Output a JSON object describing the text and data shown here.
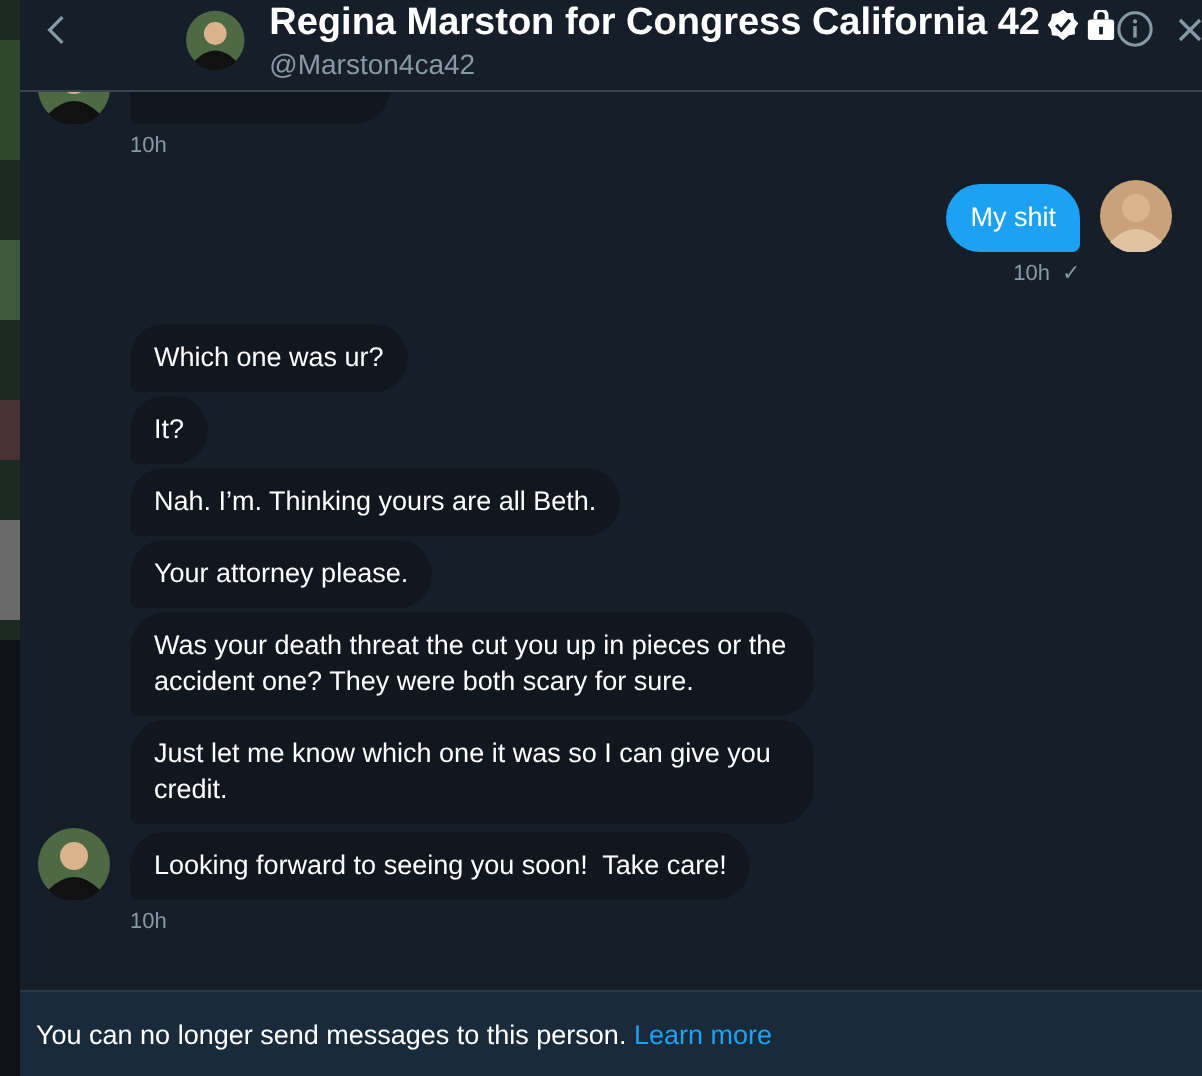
{
  "header": {
    "title": "Regina Marston for Congress California 42",
    "handle": "@Marston4ca42",
    "verified": true
  },
  "messages": [
    {
      "kind": "received",
      "cut_off": true,
      "show_avatar": true,
      "time": "10h"
    },
    {
      "kind": "sent",
      "text": "My shit",
      "show_avatar": true,
      "time": "10h",
      "status": "✓"
    },
    {
      "kind": "received",
      "text": "Which one was ur?",
      "show_avatar": false
    },
    {
      "kind": "received",
      "text": "It?",
      "show_avatar": false
    },
    {
      "kind": "received",
      "text": "Nah. I’m. Thinking yours are all Beth.",
      "show_avatar": false
    },
    {
      "kind": "received",
      "text": "Your attorney please.",
      "show_avatar": false
    },
    {
      "kind": "received",
      "text": "Was your death threat the cut you up in pieces or the accident one? They were both scary for sure.",
      "show_avatar": false
    },
    {
      "kind": "received",
      "text": "Just let me know which one it was so I can give you credit.",
      "show_avatar": false
    },
    {
      "kind": "received",
      "text": "Looking forward to seeing you soon!  Take care!",
      "show_avatar": true,
      "time": "10h"
    }
  ],
  "footer": {
    "notice": "You can no longer send messages to this person.",
    "link": "Learn more"
  }
}
